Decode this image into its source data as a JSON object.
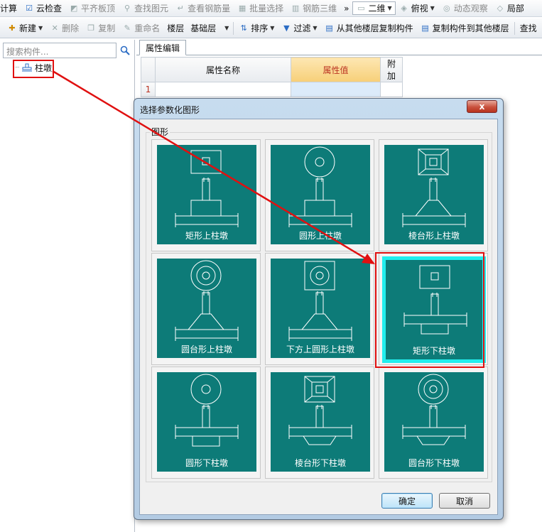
{
  "toolbar1": {
    "items": [
      "计算",
      "云检查",
      "平齐板顶",
      "查找图元",
      "查看钢筋量",
      "批量选择",
      "钢筋三维",
      "二维",
      "俯视",
      "动态观察",
      "局部"
    ],
    "more": "»"
  },
  "toolbar2": {
    "new": "新建",
    "delete": "删除",
    "copy": "复制",
    "rename": "重命名",
    "floor_label": "楼层",
    "floor_value": "基础层",
    "sort": "排序",
    "filter": "过滤",
    "copy_from": "从其他楼层复制构件",
    "copy_to": "复制构件到其他楼层",
    "find": "查找"
  },
  "left_panel": {
    "search_placeholder": "搜索构件...",
    "tree_item": "柱墩"
  },
  "property_panel": {
    "tab": "属性编辑",
    "columns": [
      "属性名称",
      "属性值",
      "附加"
    ],
    "rows": [
      {
        "num": "1",
        "name": "",
        "value": "",
        "extra": ""
      }
    ]
  },
  "dialog": {
    "title": "选择参数化图形",
    "close": "x",
    "group_label": "图形",
    "shapes": [
      {
        "label": "矩形上柱墩",
        "top": "rect",
        "base": "rect-up",
        "selected": false
      },
      {
        "label": "圆形上柱墩",
        "top": "circle",
        "base": "rect-up",
        "selected": false
      },
      {
        "label": "棱台形上柱墩",
        "top": "frustum-rect",
        "base": "trap-up",
        "selected": false
      },
      {
        "label": "圆台形上柱墩",
        "top": "frustum-circle",
        "base": "trap-up",
        "selected": false
      },
      {
        "label": "下方上圆形上柱墩",
        "top": "sq-circle",
        "base": "trap-up",
        "selected": false
      },
      {
        "label": "矩形下柱墩",
        "top": "rect",
        "base": "rect-down",
        "selected": true
      },
      {
        "label": "圆形下柱墩",
        "top": "circle",
        "base": "rect-down",
        "selected": false
      },
      {
        "label": "棱台形下柱墩",
        "top": "frustum-rect",
        "base": "trap-down",
        "selected": false
      },
      {
        "label": "圆台形下柱墩",
        "top": "frustum-circle",
        "base": "trap-down",
        "selected": false
      }
    ],
    "ok": "确定",
    "cancel": "取消"
  },
  "colors": {
    "tile": "#0d7b78",
    "selected_border": "#21eeee",
    "highlight": "#e01010"
  }
}
